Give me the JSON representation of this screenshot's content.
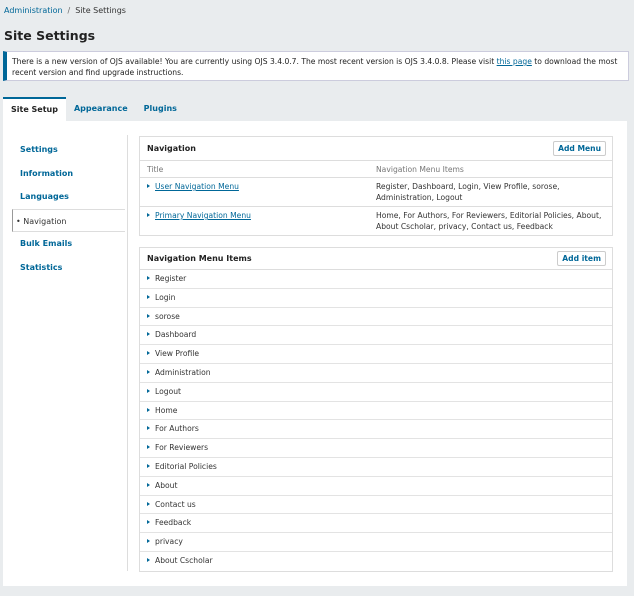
{
  "breadcrumb": {
    "root": "Administration",
    "separator": "/",
    "current": "Site Settings"
  },
  "page_title": "Site Settings",
  "notice": {
    "text_before": "There is a new version of OJS available! You are currently using OJS 3.4.0.7. The most recent version is OJS 3.4.0.8. Please visit ",
    "link": "this page",
    "text_after": " to download the most recent version and find upgrade instructions."
  },
  "tabs": [
    "Site Setup",
    "Appearance",
    "Plugins"
  ],
  "sidenav": [
    "Settings",
    "Information",
    "Languages",
    "Navigation",
    "Bulk Emails",
    "Statistics"
  ],
  "navigation_card": {
    "title": "Navigation",
    "button": "Add Menu",
    "col_title": "Title",
    "col_items": "Navigation Menu Items",
    "rows": [
      {
        "title": "User Navigation Menu",
        "items": "Register, Dashboard, Login, View Profile, sorose, Administration, Logout"
      },
      {
        "title": "Primary Navigation Menu",
        "items": "Home, For Authors, For Reviewers, Editorial Policies, About, About Cscholar, privacy, Contact us, Feedback"
      }
    ]
  },
  "items_card": {
    "title": "Navigation Menu Items",
    "button": "Add item",
    "items": [
      "Register",
      "Login",
      "sorose",
      "Dashboard",
      "View Profile",
      "Administration",
      "Logout",
      "Home",
      "For Authors",
      "For Reviewers",
      "Editorial Policies",
      "About",
      "Contact us",
      "Feedback",
      "privacy",
      "About Cscholar"
    ]
  },
  "colors": {
    "accent": "#006798",
    "background": "#e9ecee"
  },
  "icons": {
    "row_expand": "triangle-right-icon"
  }
}
